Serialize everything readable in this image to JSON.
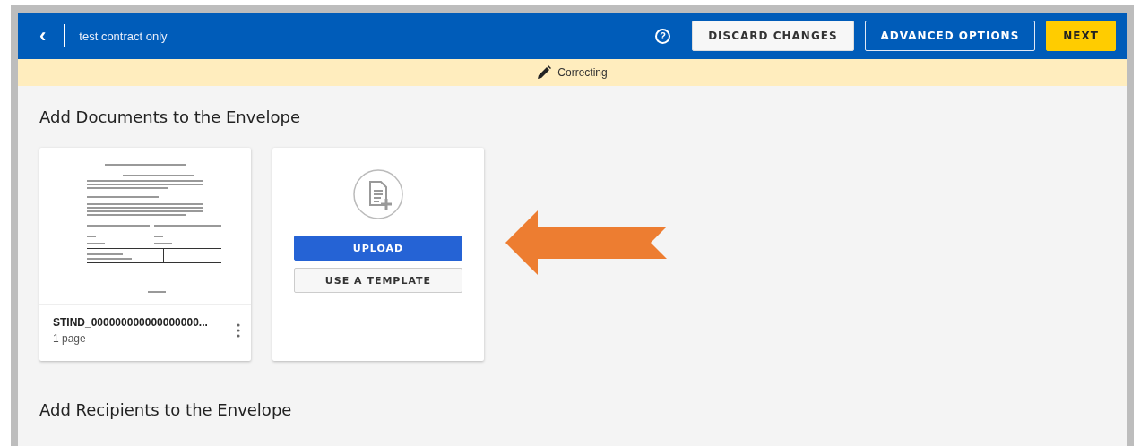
{
  "header": {
    "back": "‹",
    "title": "test contract only",
    "help": "?",
    "buttons": [
      {
        "label": "DISCARD CHANGES",
        "kind": "secondary"
      },
      {
        "label": "ADVANCED OPTIONS",
        "kind": "outline"
      },
      {
        "label": "NEXT",
        "kind": "primary"
      }
    ]
  },
  "banner": {
    "text": "Correcting"
  },
  "documents": {
    "heading": "Add Documents to the Envelope",
    "cards": [
      {
        "kind": "document",
        "name": "STIND_000000000000000000...",
        "pages": "1 page"
      }
    ],
    "add_card": {
      "buttons": [
        {
          "label": "UPLOAD",
          "kind": "primary"
        },
        {
          "label": "USE A TEMPLATE",
          "kind": "secondary"
        }
      ]
    }
  },
  "recipients": {
    "heading": "Add Recipients to the Envelope"
  }
}
